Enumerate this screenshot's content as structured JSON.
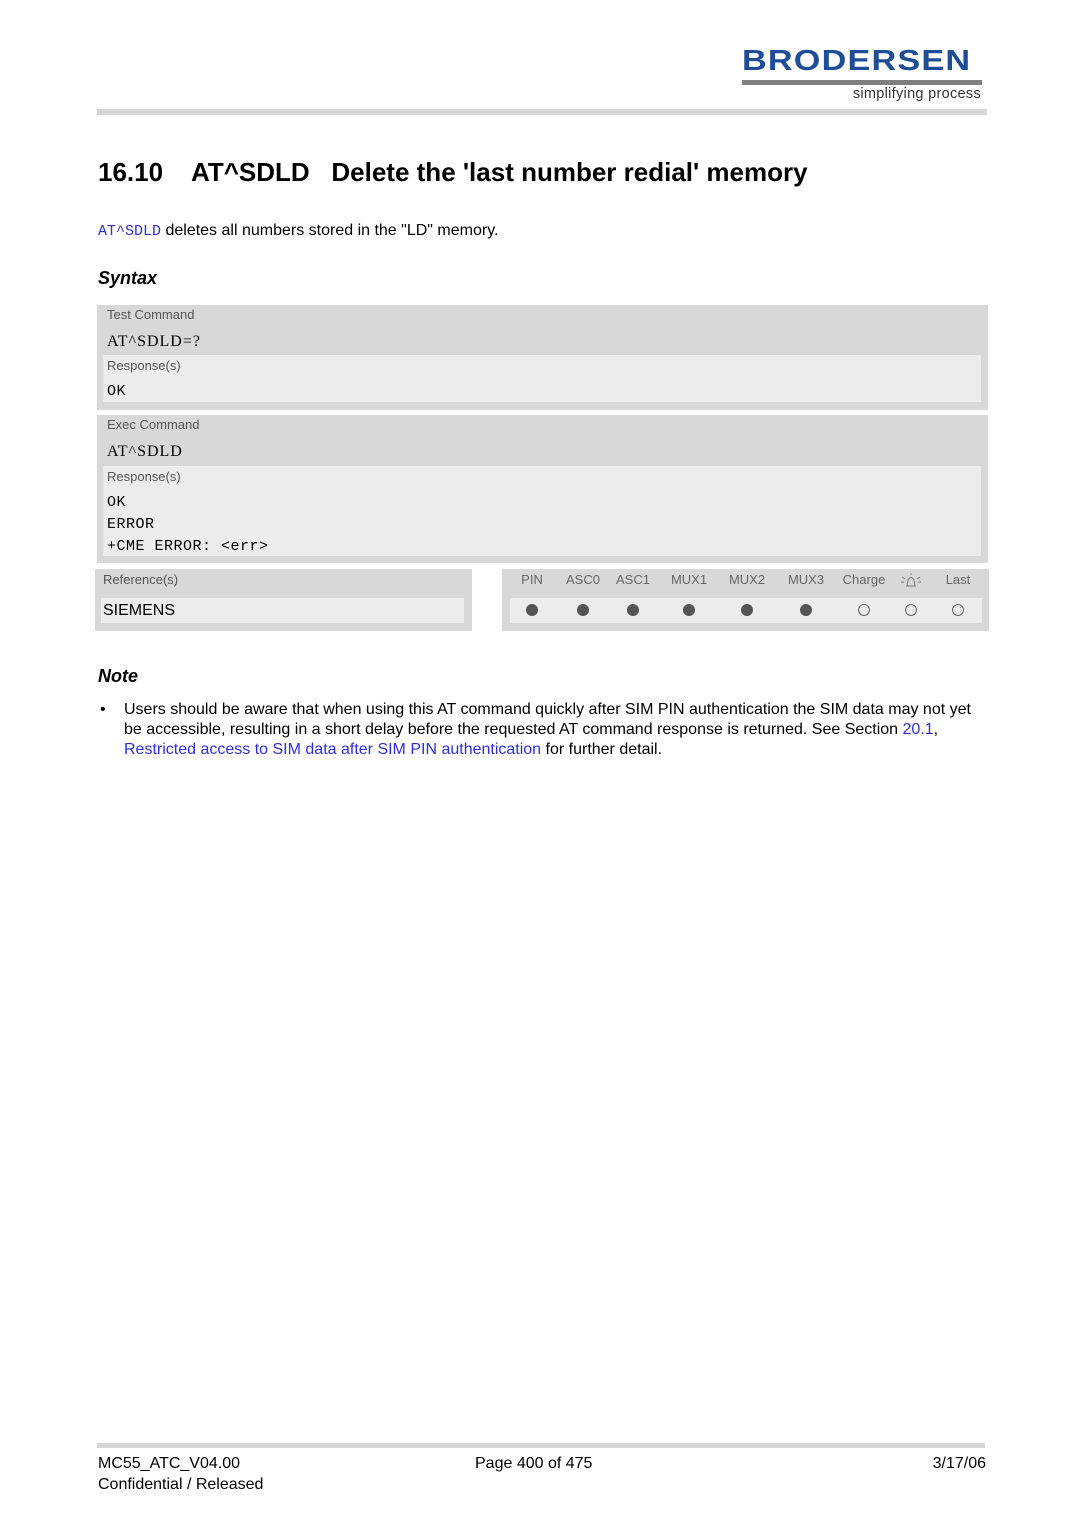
{
  "header": {
    "logo_word": "BRODERSEN",
    "logo_tagline": "simplifying process",
    "brand_color": "#1f4e99"
  },
  "section": {
    "number": "16.10",
    "command": "AT^SDLD",
    "title": "Delete the 'last number redial' memory"
  },
  "intro": {
    "command_link": "AT^SDLD",
    "text": " deletes all numbers stored in the \"LD\" memory."
  },
  "syntax": {
    "heading": "Syntax",
    "test_command": {
      "label": "Test Command",
      "command": "AT^SDLD=?",
      "responses_label": "Response(s)",
      "responses": [
        "OK"
      ]
    },
    "exec_command": {
      "label": "Exec Command",
      "command": "AT^SDLD",
      "responses_label": "Response(s)",
      "responses": [
        "OK",
        "ERROR",
        "+CME ERROR: <err>"
      ]
    },
    "references": {
      "label": "Reference(s)",
      "value": "SIEMENS"
    },
    "flags": [
      {
        "label": "PIN",
        "state": "filled"
      },
      {
        "label": "ASC0",
        "state": "filled"
      },
      {
        "label": "ASC1",
        "state": "filled"
      },
      {
        "label": "MUX1",
        "state": "filled"
      },
      {
        "label": "MUX2",
        "state": "filled"
      },
      {
        "label": "MUX3",
        "state": "filled"
      },
      {
        "label": "Charge",
        "state": "empty"
      },
      {
        "label": "",
        "icon": "alarm-bell-icon",
        "state": "empty"
      },
      {
        "label": "Last",
        "state": "empty"
      }
    ]
  },
  "note": {
    "heading": "Note",
    "bullet": "•",
    "text_before": "Users should be aware that when using this AT command quickly after SIM PIN authentication the SIM data may not yet be accessible, resulting in a short delay before the requested AT command response is returned. See Section ",
    "section_link": "20.1",
    "separator": ", ",
    "title_link": "Restricted access to SIM data after SIM PIN authentication",
    "text_after": " for further detail."
  },
  "footer": {
    "doc_id": "MC55_ATC_V04.00",
    "page": "Page 400 of 475",
    "date": "3/17/06",
    "status": "Confidential / Released"
  }
}
